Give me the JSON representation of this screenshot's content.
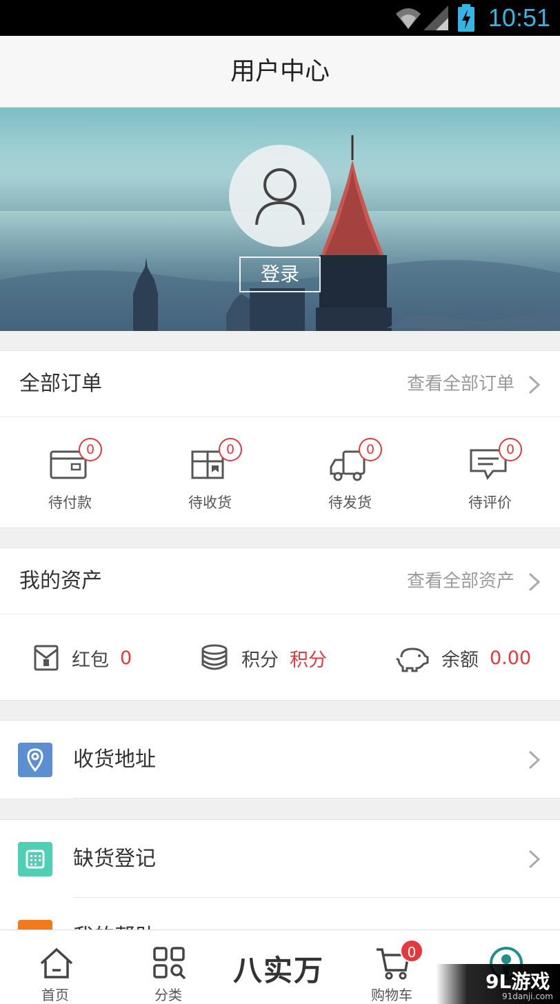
{
  "status_bar": {
    "time": "10:51"
  },
  "title_bar": {
    "title": "用户中心"
  },
  "hero": {
    "login_label": "登录"
  },
  "orders": {
    "title": "全部订单",
    "view_all": "查看全部订单",
    "items": [
      {
        "label": "待付款",
        "count": "0",
        "icon": "wallet-icon"
      },
      {
        "label": "待收货",
        "count": "0",
        "icon": "package-icon"
      },
      {
        "label": "待发货",
        "count": "0",
        "icon": "truck-icon"
      },
      {
        "label": "待评价",
        "count": "0",
        "icon": "comment-icon"
      }
    ]
  },
  "assets": {
    "title": "我的资产",
    "view_all": "查看全部资产",
    "items": [
      {
        "label": "红包",
        "value": "0",
        "icon": "red-envelope-icon"
      },
      {
        "label": "积分",
        "value": "积分",
        "icon": "coins-icon"
      },
      {
        "label": "余额",
        "value": "0.00",
        "icon": "piggy-bank-icon"
      }
    ]
  },
  "menu": {
    "items": [
      {
        "label": "收货地址",
        "icon": "location-icon",
        "color": "#5b8fd0"
      },
      {
        "label": "缺货登记",
        "icon": "calendar-icon",
        "color": "#4fcfb3"
      },
      {
        "label": "我的帮助",
        "icon": "help-icon",
        "color": "#f07a1c"
      }
    ]
  },
  "tab_bar": {
    "home": "首页",
    "category": "分类",
    "brand": "八实万",
    "cart": "购物车",
    "cart_count": "0"
  },
  "watermark": {
    "main": "9L游戏",
    "sub": "91danji.com"
  },
  "colors": {
    "accent": "#e4393c",
    "time": "#33b5e5"
  }
}
